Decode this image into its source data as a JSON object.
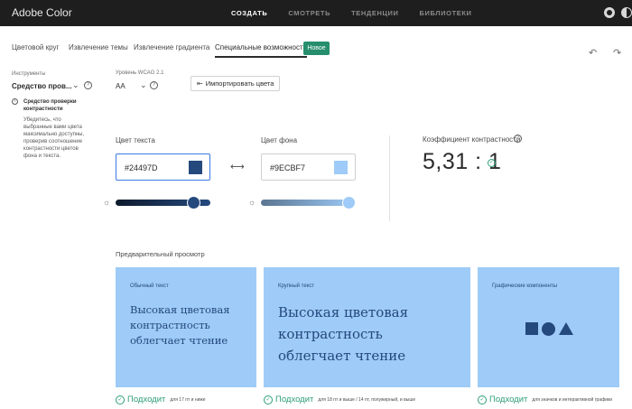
{
  "app": {
    "title": "Adobe Color"
  },
  "nav": {
    "items": [
      {
        "label": "СОЗДАТЬ",
        "active": true
      },
      {
        "label": "СМОТРЕТЬ",
        "active": false
      },
      {
        "label": "ТЕНДЕНЦИИ",
        "active": false
      },
      {
        "label": "БИБЛИОТЕКИ",
        "active": false
      }
    ]
  },
  "tabs": [
    {
      "label": "Цветовой круг"
    },
    {
      "label": "Извлечение темы"
    },
    {
      "label": "Извлечение градиента"
    },
    {
      "label": "Специальные возможности",
      "active": true
    }
  ],
  "badge": {
    "label": "Новое"
  },
  "sidebar": {
    "section_label": "Инструменты",
    "selected_tool": "Средство пров...",
    "info_heading": "Средство проверки контрастности",
    "info_text": "Убедитесь, что выбранные вами цвета максимально доступны, проверив соотношение контрастности цветов фона и текста."
  },
  "wcag": {
    "label": "Уровень WCAG 2.1",
    "value": "AA"
  },
  "import_button": {
    "label": "Импортировать цвета"
  },
  "text_color": {
    "label": "Цвет текста",
    "value": "#24497D",
    "swatch": "#24497d",
    "brightness": 0.88
  },
  "bg_color": {
    "label": "Цвет фона",
    "value": "#9ECBF7",
    "swatch": "#9ecbf7",
    "brightness": 1.0
  },
  "ratio": {
    "label": "Коэффициент контрастности",
    "value": "5,31 : 1"
  },
  "preview": {
    "label": "Предварительный просмотр",
    "cards": [
      {
        "title": "Обычный текст",
        "body": "Высокая цветовая контрастность облегчает чтение"
      },
      {
        "title": "Крупный текст",
        "body": "Высокая цветовая контрастность облегчает чтение"
      },
      {
        "title": "Графические компоненты"
      }
    ],
    "results": [
      {
        "label": "Подходит",
        "note": "для 17 пт и ниже"
      },
      {
        "label": "Подходит",
        "note": "для 18 пт и выше / 14 пт, полужирный, и выше"
      },
      {
        "label": "Подходит",
        "note": "для значков и интерактивной графики"
      }
    ]
  },
  "colors": {
    "accent": "#268e6c",
    "pass": "#2d9d78",
    "topbar": "#1e1e1e"
  }
}
